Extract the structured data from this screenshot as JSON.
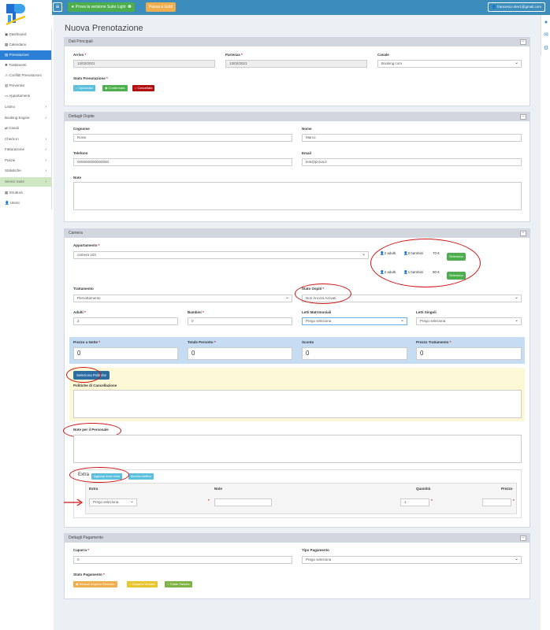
{
  "topbar": {
    "promo_label": "Prova la versione Suite Light",
    "upgrade_label": "Passa a Gold",
    "user_email": "francesco.ster1@gmail.com"
  },
  "sidebar": {
    "items": [
      {
        "label": "Dashboard"
      },
      {
        "label": "Calendario"
      },
      {
        "label": "Prenotazioni"
      },
      {
        "label": "Trattamenti"
      },
      {
        "label": "Conflitti Prenotazioni"
      },
      {
        "label": "Preventivi"
      },
      {
        "label": "Appartamenti"
      },
      {
        "label": "Listino"
      },
      {
        "label": "Booking Engine"
      },
      {
        "label": "Canali"
      },
      {
        "label": "Check-in"
      },
      {
        "label": "Fatturazione"
      },
      {
        "label": "Pulizie"
      },
      {
        "label": "Statistiche"
      },
      {
        "label": "Servizi Suite"
      },
      {
        "label": "Struttura"
      },
      {
        "label": "Utenti"
      }
    ]
  },
  "page_title": "Nuova Prenotazione",
  "dati_principali": {
    "title": "Dati Principali",
    "arrivo_label": "Arrivo",
    "arrivo_value": "12/02/2021",
    "partenza_label": "Partenza",
    "partenza_value": "13/02/2021",
    "canale_label": "Canale",
    "canale_value": "Booking.com",
    "stato_label": "Stato Prenotazione",
    "stato_options": [
      "Opzionata",
      "Confermata",
      "Cancellata"
    ]
  },
  "ospite": {
    "title": "Dettagli Ospite",
    "cognome_label": "Cognome",
    "cognome_value": "Rossi",
    "nome_label": "Nome",
    "nome_value": "Marco",
    "telefono_label": "Telefono",
    "telefono_value": "0000000000000000",
    "email_label": "Email",
    "email_value": "test@prova.it",
    "note_label": "Note"
  },
  "camera": {
    "title": "Camera",
    "appartamento_label": "Appartamento",
    "appartamento_value": "camera 103",
    "offers": [
      {
        "adulti": "2 adulti",
        "bambini": "0 bambini",
        "price": "70 €",
        "button": "Seleziona"
      },
      {
        "adulti": "2 adulti",
        "bambini": "1 bambini",
        "price": "90 €",
        "button": "Seleziona"
      }
    ],
    "trattamento_label": "Trattamento",
    "trattamento_value": "Pernottamento",
    "stato_ospiti_label": "Stato Ospiti",
    "stato_ospiti_value": "Non Ancora Arrivati",
    "adulti_label": "Adulti",
    "adulti_value": "2",
    "bambini_label": "Bambini",
    "bambini_value": "0",
    "letti_matr_label": "Letti Matrimoniali",
    "letti_matr_value": "Prego seleziona",
    "letti_sing_label": "Letti Singoli",
    "letti_sing_value": "Prego seleziona",
    "prezzo_notte_label": "Prezzo a Notte",
    "prezzo_notte_value": "0",
    "totale_pernotto_label": "Totale Pernotto",
    "totale_pernotto_value": "0",
    "sconto_label": "Sconto",
    "sconto_value": "0",
    "prezzo_trattamento_label": "Prezzo Trattamento",
    "prezzo_trattamento_value": "0",
    "politiche_button": "Seleziona Politiche",
    "cancellazione_label": "Politiche di Cancellazione",
    "note_personale_label": "Note per il Personale",
    "extra_label": "Extra",
    "aggiungi_label": "Aggiungi nuovo extra",
    "annulla_label": "Annulla modifica",
    "extra_headers": [
      "Extra",
      "Note",
      "Quantità",
      "Prezzo"
    ],
    "extra_select": "Prego seleziona",
    "extra_qty": "1"
  },
  "pagamento": {
    "title": "Dettagli Pagamento",
    "caparra_label": "Caparra",
    "caparra_value": "0",
    "tipo_label": "Tipo Pagamento",
    "tipo_value": "Prego seleziona",
    "stato_label": "Stato Pagamento",
    "stato_options": [
      "Nessun Importo Ricevuto",
      "Caparra Versata",
      "Totale Saldato"
    ]
  },
  "colors": {
    "primary": "#3c8dbc",
    "green": "#4cae4c",
    "orange": "#f0ad4e",
    "red": "#d01010",
    "panel_header": "#d2d6de",
    "yellow_band": "#fcf8d6",
    "blue_band": "#c6dcf2"
  }
}
